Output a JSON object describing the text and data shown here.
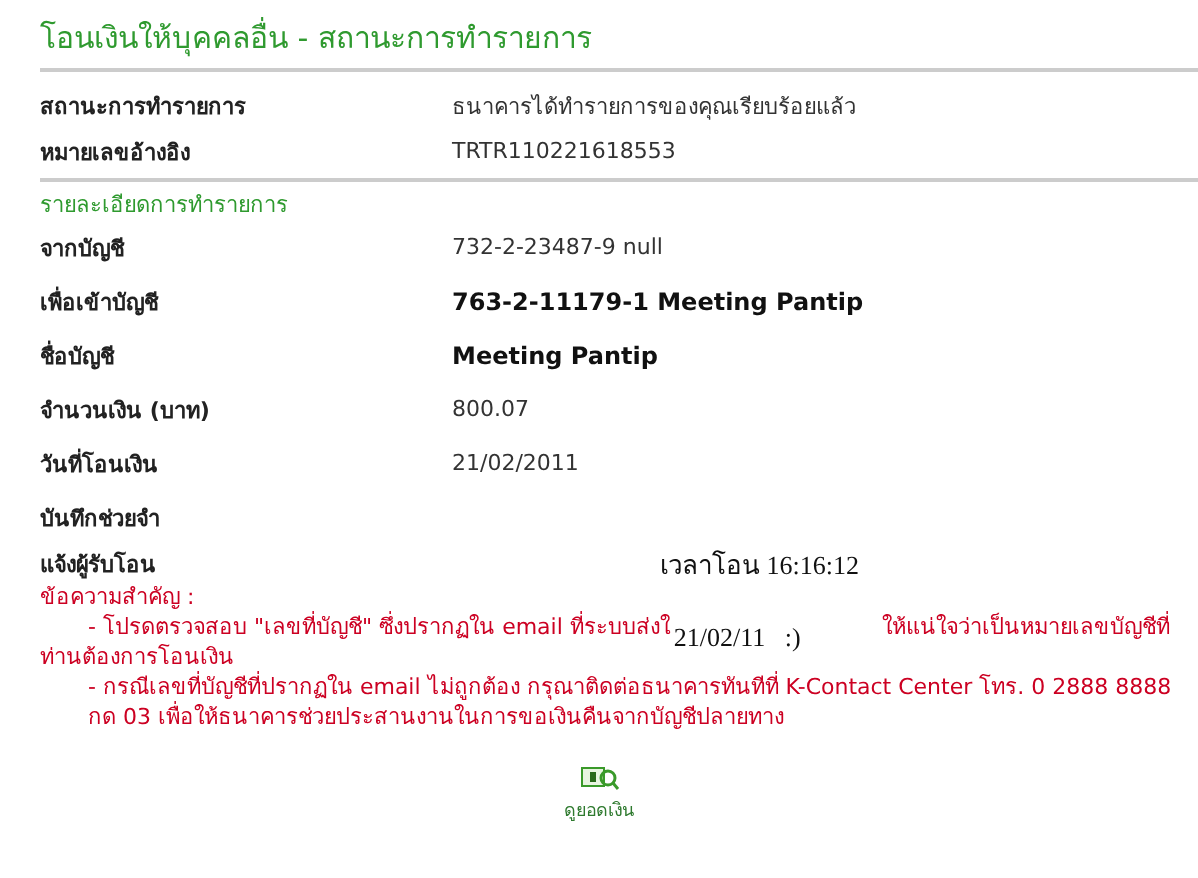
{
  "title": "โอนเงินให้บุคคลอื่น - สถานะการทำรายการ",
  "status": [
    {
      "label": "สถานะการทำรายการ",
      "value": "ธนาคารได้ทำรายการของคุณเรียบร้อยแล้ว"
    },
    {
      "label": "หมายเลขอ้างอิง",
      "value": "TRTR110221618553"
    }
  ],
  "details": {
    "heading": "รายละเอียดการทำรายการ",
    "rows": [
      {
        "label": "จากบัญชี",
        "value": "732-2-23487-9 null",
        "bold": false
      },
      {
        "label": "เพื่อเข้าบัญชี",
        "value": "763-2-11179-1 Meeting Pantip",
        "bold": true
      },
      {
        "label": "ชื่อบัญชี",
        "value": "Meeting Pantip",
        "bold": true
      },
      {
        "label": "จำนวนเงิน (บาท)",
        "value": "800.07",
        "bold": false
      },
      {
        "label": "วันที่โอนเงิน",
        "value": "21/02/2011",
        "bold": false
      },
      {
        "label": "บันทึกช่วยจำ"
      }
    ]
  },
  "notify": {
    "label": "แจ้งผู้รับโอน",
    "stamp": "เวลาโอน 16:16:12"
  },
  "notice": {
    "heading": "ข้อความสำคัญ :",
    "first": {
      "before": "- โปรดตรวจสอบ \"เลขที่บัญชี\" ซึ่งปรากฏใน email ที่ระบบส่งใ",
      "stamp": "21/02/11   :)",
      "after": "ให้แน่ใจว่าเป็นหมายเลขบัญชีที่",
      "continued": "ท่านต้องการโอนเงิน"
    },
    "second": "- กรณีเลขที่บัญชีที่ปรากฏใน email ไม่ถูกต้อง กรุณาติดต่อธนาคารทันทีที่ K-Contact Center โทร. 0 2888 8888 กด 03 เพื่อให้ธนาคารช่วยประสานงานในการขอเงินคืนจากบัญชีปลายทาง"
  },
  "action": {
    "label": "ดูยอดเงิน"
  }
}
